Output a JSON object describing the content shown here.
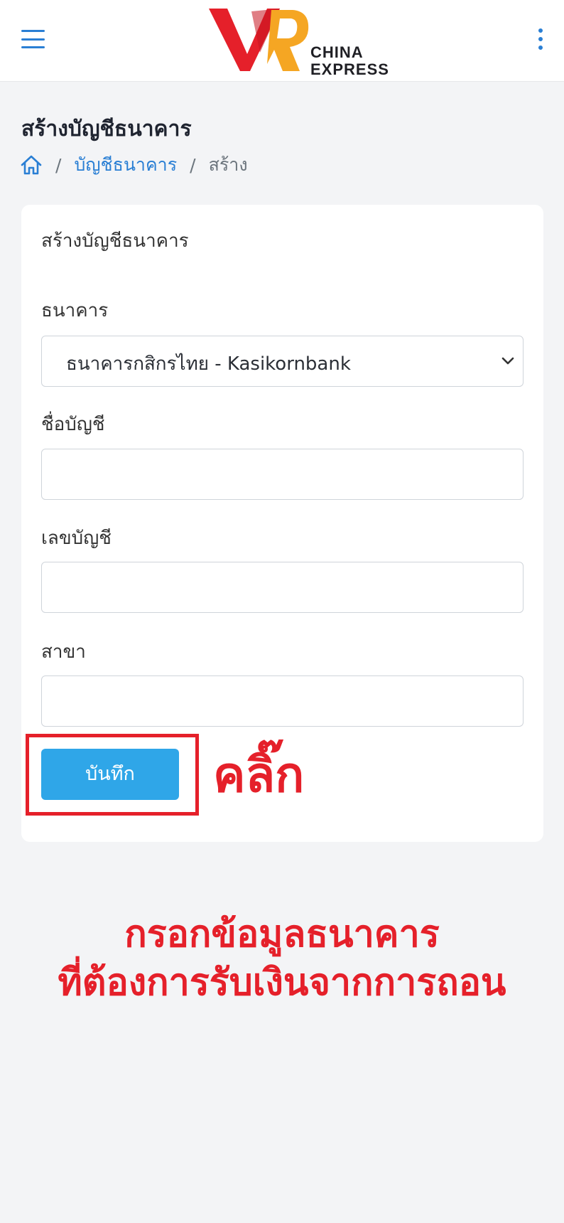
{
  "header": {
    "menu_icon": "hamburger-menu-icon",
    "logo_text_line1": "CHINA",
    "logo_text_line2": "EXPRESS",
    "more_icon": "vertical-dots-icon",
    "colors": {
      "accent": "#2a7fd4",
      "logo_red": "#e5202a",
      "logo_orange": "#f5a623"
    }
  },
  "page": {
    "title": "สร้างบัญชีธนาคาร",
    "breadcrumb": {
      "home_icon": "home-icon",
      "separator": "/",
      "link": "บัญชีธนาคาร",
      "current": "สร้าง"
    }
  },
  "form": {
    "card_title": "สร้างบัญชีธนาคาร",
    "bank": {
      "label": "ธนาคาร",
      "selected": "ธนาคารกสิกรไทย - Kasikornbank"
    },
    "account_name": {
      "label": "ชื่อบัญชี",
      "value": ""
    },
    "account_number": {
      "label": "เลขบัญชี",
      "value": ""
    },
    "branch": {
      "label": "สาขา",
      "value": ""
    },
    "save_label": "บันทึก"
  },
  "annotations": {
    "click": "คลิ๊ก",
    "instruction_line1": "กรอกข้อมูลธนาคาร",
    "instruction_line2": "ที่ต้องการรับเงินจากการถอน",
    "color": "#e5202a"
  }
}
